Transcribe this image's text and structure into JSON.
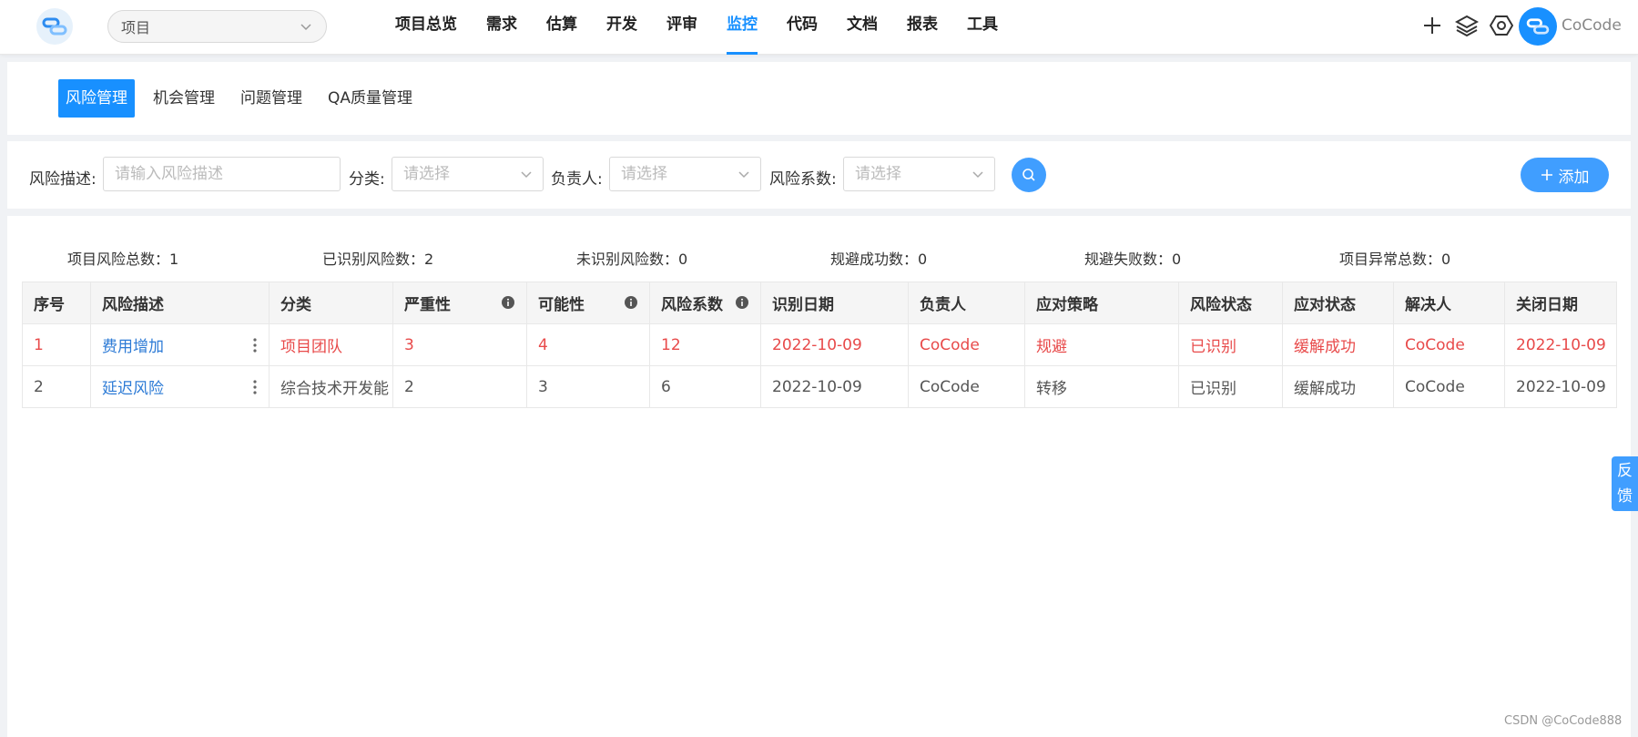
{
  "header": {
    "project_select_value": "项目",
    "nav": [
      "项目总览",
      "需求",
      "估算",
      "开发",
      "评审",
      "监控",
      "代码",
      "文档",
      "报表",
      "工具"
    ],
    "active_nav": "监控",
    "user_name": "CoCode"
  },
  "tabs": [
    "风险管理",
    "机会管理",
    "问题管理",
    "QA质量管理"
  ],
  "filters": {
    "desc_label": "风险描述:",
    "desc_placeholder": "请输入风险描述",
    "category_label": "分类:",
    "category_placeholder": "请选择",
    "owner_label": "负责人:",
    "owner_placeholder": "请选择",
    "factor_label": "风险系数:",
    "factor_placeholder": "请选择",
    "add_label": "添加"
  },
  "stats": [
    "项目风险总数：1",
    "已识别风险数：2",
    "未识别风险数：0",
    "规避成功数：0",
    "规避失败数：0",
    "项目异常总数：0"
  ],
  "table": {
    "columns": [
      "序号",
      "风险描述",
      "分类",
      "严重性",
      "可能性",
      "风险系数",
      "识别日期",
      "负责人",
      "应对策略",
      "风险状态",
      "应对状态",
      "解决人",
      "关闭日期"
    ],
    "rows": [
      [
        "1",
        "费用增加",
        "项目团队",
        "3",
        "4",
        "12",
        "2022-10-09",
        "CoCode",
        "规避",
        "已识别",
        "缓解成功",
        "CoCode",
        "2022-10-09"
      ],
      [
        "2",
        "延迟风险",
        "综合技术开发能",
        "2",
        "3",
        "6",
        "2022-10-09",
        "CoCode",
        "转移",
        "已识别",
        "缓解成功",
        "CoCode",
        "2022-10-09"
      ]
    ]
  },
  "feedback": [
    "反",
    "馈"
  ],
  "watermark": "CSDN @CoCode888",
  "colors": {
    "primary": "#1890ff",
    "danger": "#e84a4a",
    "link": "#2d7bd6"
  }
}
